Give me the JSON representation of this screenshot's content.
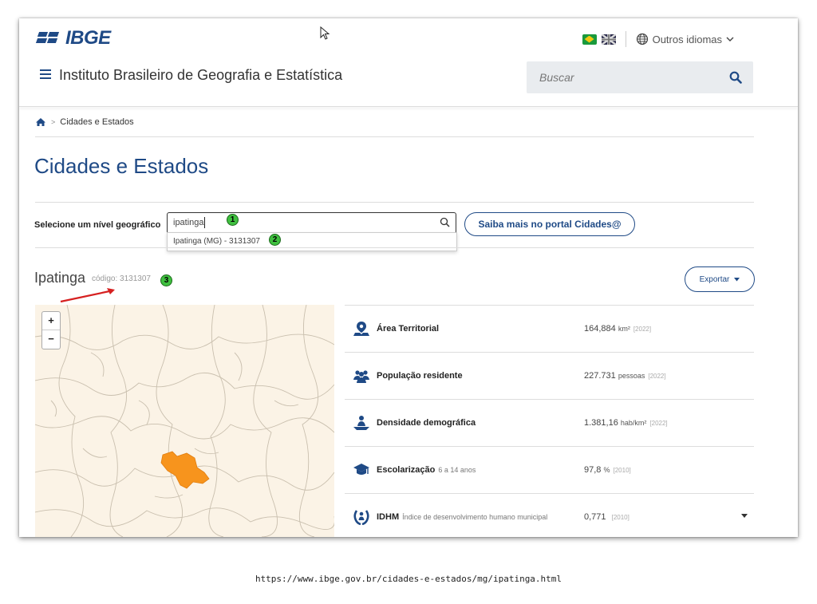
{
  "header": {
    "logo_text": "IBGE",
    "lang_other": "Outros idiomas",
    "institute": "Instituto Brasileiro de Geografia e Estatística",
    "search_placeholder": "Buscar"
  },
  "breadcrumb": {
    "current": "Cidades e Estados"
  },
  "page": {
    "title": "Cidades e Estados",
    "select_label": "Selecione um nível geográfico",
    "select_value": "ipatinga",
    "dropdown_option": "Ipatinga (MG) - 3131307",
    "saiba_button": "Saiba mais no portal Cidades@",
    "city_name": "Ipatinga",
    "city_code": "código: 3131307",
    "export_button": "Exportar",
    "badges": [
      "1",
      "2",
      "3"
    ]
  },
  "map": {
    "zoom_in": "+",
    "zoom_out": "−",
    "highlight_color": "#f7941d"
  },
  "stats": [
    {
      "label": "Área Territorial",
      "sub": "",
      "value": "164,884",
      "unit": "km²",
      "year": "[2022]"
    },
    {
      "label": "População residente",
      "sub": "",
      "value": "227.731",
      "unit": "pessoas",
      "year": "[2022]"
    },
    {
      "label": "Densidade demográfica",
      "sub": "",
      "value": "1.381,16",
      "unit": "hab/km²",
      "year": "[2022]"
    },
    {
      "label": "Escolarização",
      "sub": "6 a 14 anos",
      "value": "97,8",
      "unit": "%",
      "year": "[2010]"
    },
    {
      "label": "IDHM",
      "sub": "Índice de desenvolvimento humano municipal",
      "value": "0,771",
      "unit": "",
      "year": "[2010]"
    }
  ],
  "footer_url": "https://www.ibge.gov.br/cidades-e-estados/mg/ipatinga.html",
  "colors": {
    "brand_blue": "#1f4a86",
    "badge_green": "#3fbf3f",
    "arrow_red": "#d62020"
  }
}
